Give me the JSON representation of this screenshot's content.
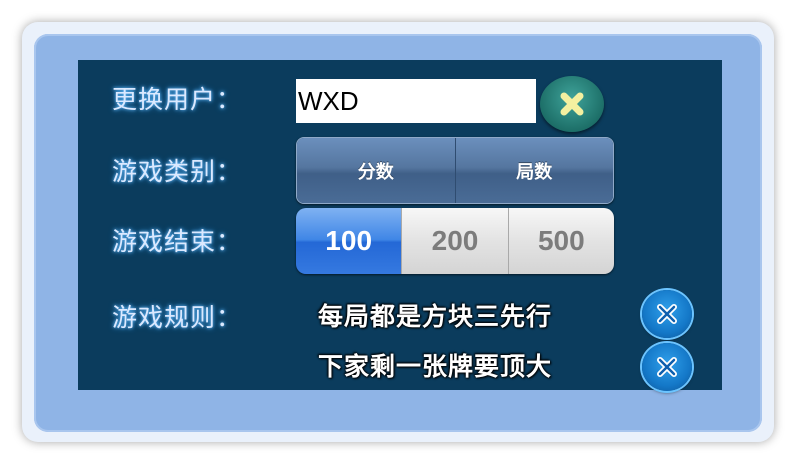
{
  "settings": {
    "change_user_label": "更换用户：",
    "username_value": "WXD",
    "game_type_label": "游戏类别：",
    "game_type_options": [
      "分数",
      "局数"
    ],
    "game_end_label": "游戏结束：",
    "game_end_options": [
      "100",
      "200",
      "500"
    ],
    "game_end_selected": "100",
    "rules_label": "游戏规则：",
    "rules": [
      "每局都是方块三先行",
      "下家剩一张牌要顶大"
    ]
  },
  "icons": {
    "clear_user": "close-icon",
    "rule_toggle": "x-toggle-icon"
  },
  "colors": {
    "panel_bg": "#0b3c5d",
    "frame_bg": "#8fb4e6",
    "selected_blue": "#3f86e6",
    "clear_button_teal": "#1d6f68",
    "clear_icon_yellow": "#f4f0a0"
  }
}
